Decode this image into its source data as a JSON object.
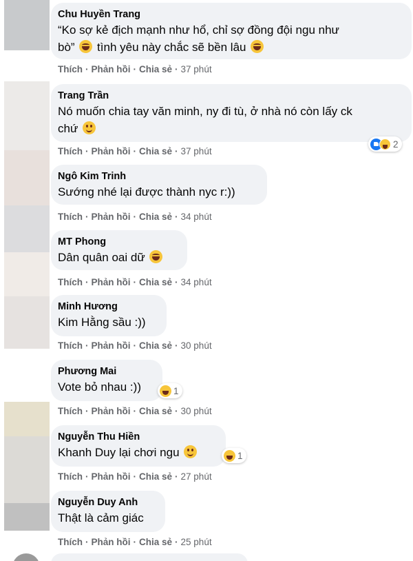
{
  "action_labels": {
    "like": "Thích",
    "reply": "Phản hồi",
    "share": "Chia sẻ",
    "separator": "·"
  },
  "comments": [
    {
      "author": "Chu Huyền Trang",
      "text1": "“Ko sợ kẻ địch mạnh như hổ, chỉ sợ đồng đội ngu như",
      "text2": "bò”",
      "text3": "tình yêu này chắc sẽ bền lâu",
      "time": "37 phút"
    },
    {
      "author": "Trang Trần",
      "text1": "Nó muốn chia tay văn minh, ny đi tù, ở nhà nó còn lấy ck",
      "text2": "chứ",
      "time": "37 phút",
      "reaction_count": "2",
      "reaction_icons": [
        "like-icon",
        "haha-icon"
      ]
    },
    {
      "author": "Ngô Kim Trinh",
      "text1": "Sướng nhé lại được thành nyc r:))",
      "time": "34 phút"
    },
    {
      "author": "MT Phong",
      "text1": "Dân quân oai dữ",
      "time": "34 phút"
    },
    {
      "author": "Minh Hương",
      "text1": "Kim Hằng sầu :))",
      "time": "30 phút"
    },
    {
      "author": "Phương Mai",
      "text1": "Vote bỏ nhau :))",
      "time": "30 phút",
      "reaction_count": "1",
      "reaction_icons": [
        "haha-icon"
      ]
    },
    {
      "author": "Nguyễn Thu Hiền",
      "text1": "Khanh Duy lại chơi ngu",
      "time": "27 phút",
      "reaction_count": "1",
      "reaction_icons": [
        "haha-icon"
      ]
    },
    {
      "author": "Nguyễn Duy Anh",
      "text1": "Thật là cảm giác",
      "time": "25 phút"
    }
  ],
  "avatar_colors": [
    "#c8cacc",
    "#eceae8",
    "#e8e0dc",
    "#dcdcde",
    "#f0ebe7",
    "#e6e2e0",
    "#e6e0cc",
    "#dcdad6",
    "#c0c0c0"
  ],
  "colors": {
    "bubble": "#f0f2f5",
    "meta": "#65676b",
    "like_blue": "#1877f2",
    "haha_yellow": "#f7c53a"
  }
}
